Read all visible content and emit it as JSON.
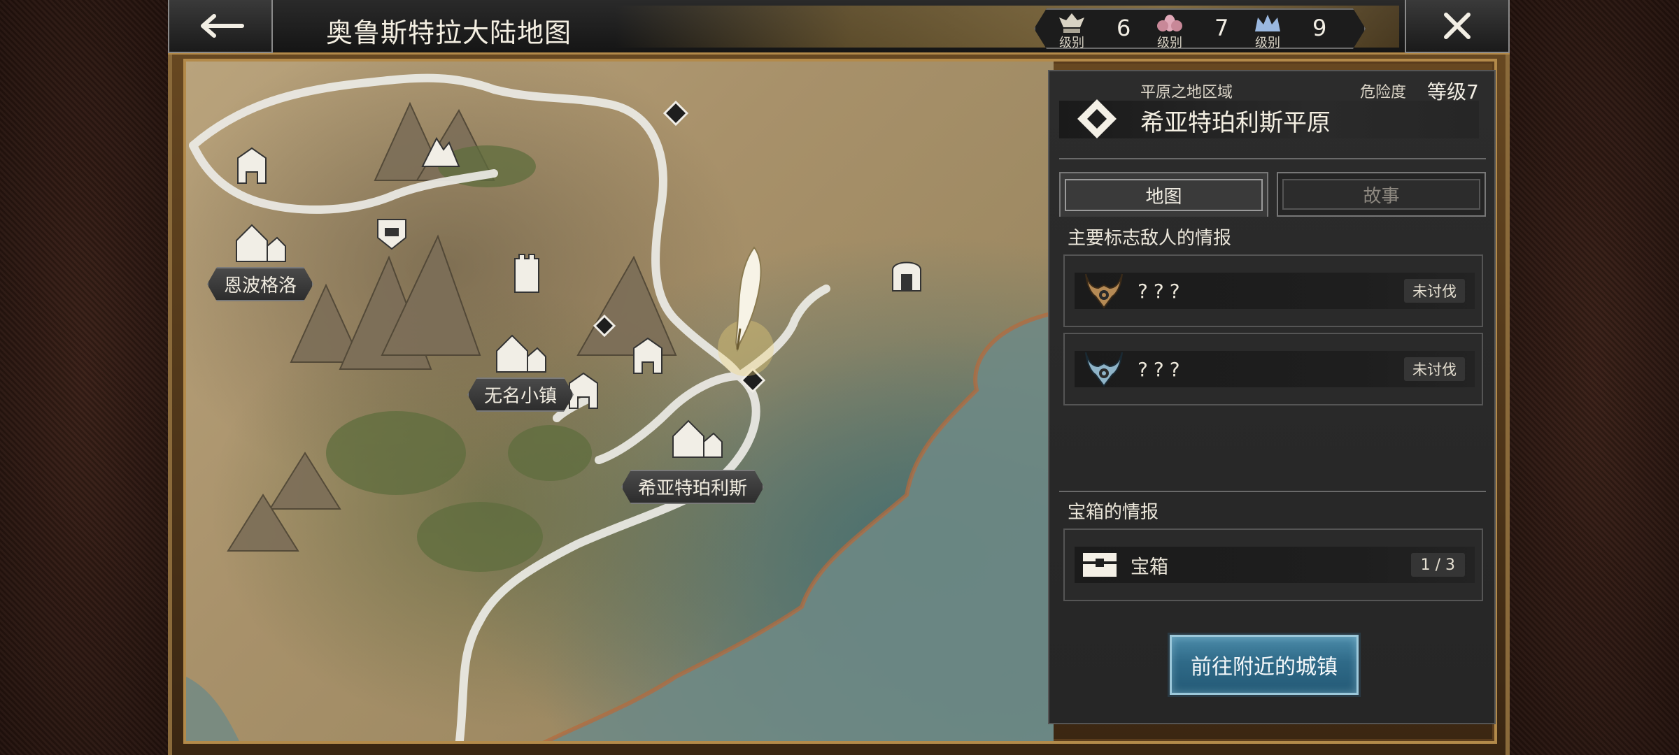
{
  "header": {
    "title": "奥鲁斯特拉大陆地图",
    "back_icon": "back-arrow-icon",
    "close_icon": "close-icon",
    "levels": [
      {
        "icon": "rank-crest-icon",
        "caption": "级别",
        "value": "6"
      },
      {
        "icon": "lotus-crest-icon",
        "caption": "级别",
        "value": "7"
      },
      {
        "icon": "crown-crest-icon",
        "caption": "级别",
        "value": "9"
      }
    ]
  },
  "map": {
    "locations": [
      {
        "name": "恩波格洛",
        "icon": "town-icon"
      },
      {
        "name": "无名小镇",
        "icon": "town-icon"
      },
      {
        "name": "希亚特珀利斯",
        "icon": "town-icon"
      }
    ],
    "current_marker_icon": "quill-marker-icon"
  },
  "panel": {
    "region_caption": "平原之地区域",
    "danger_label": "危险度",
    "danger_level": "等级7",
    "region_name": "希亚特珀利斯平原",
    "tabs": [
      {
        "label": "地图",
        "active": true
      },
      {
        "label": "故事",
        "active": false
      }
    ],
    "enemy_section_title": "主要标志敌人的情报",
    "enemies": [
      {
        "name": "???",
        "status": "未讨伐",
        "icon_color": "#b58a55"
      },
      {
        "name": "???",
        "status": "未讨伐",
        "icon_color": "#8fb4c8"
      }
    ],
    "chest_section_title": "宝箱的情报",
    "chest": {
      "label": "宝箱",
      "count": "1 / 3"
    },
    "go_town_button": "前往附近的城镇"
  }
}
